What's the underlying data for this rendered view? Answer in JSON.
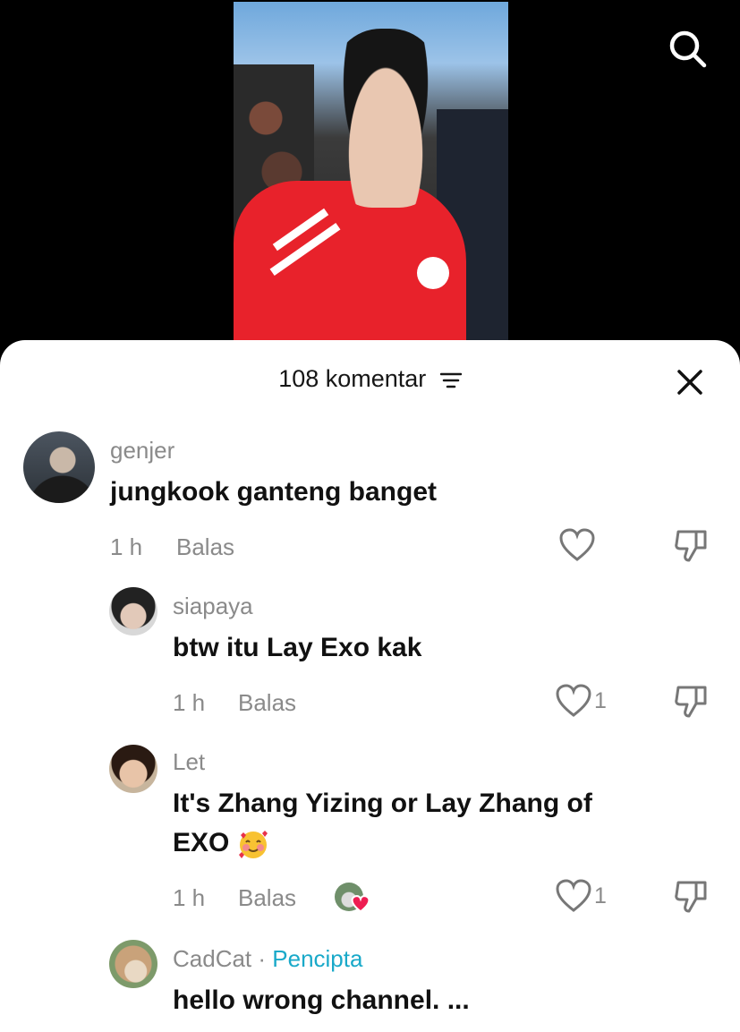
{
  "header": {
    "comment_count_label": "108 komentar"
  },
  "icons": {
    "search": "search-icon",
    "filter": "filter-icon",
    "close": "close-icon",
    "like": "heart-icon",
    "dislike": "thumbs-down-icon"
  },
  "comments": [
    {
      "username": "genjer",
      "text": "jungkook ganteng banget",
      "time": "1 h",
      "reply_label": "Balas",
      "likes": ""
    },
    {
      "username": "siapaya",
      "text": "btw itu Lay Exo kak",
      "time": "1 h",
      "reply_label": "Balas",
      "likes": "1"
    },
    {
      "username": "Let",
      "text_line1": "It's Zhang Yizing or Lay Zhang of",
      "text_line2": "EXO",
      "time": "1 h",
      "reply_label": "Balas",
      "likes": "1"
    },
    {
      "username": "CadCat",
      "separator": " · ",
      "creator_label": "Pencipta",
      "text": "hello wrong channel. ..."
    }
  ],
  "colors": {
    "accent_creator": "#19a9c9",
    "jacket_red": "#e8222b",
    "liked_heart": "#ee1d52"
  }
}
